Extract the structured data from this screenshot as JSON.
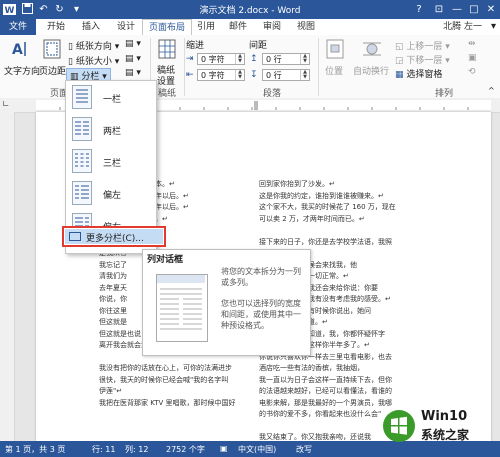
{
  "titlebar": {
    "title": "演示文档 2.docx - Word",
    "help": "?",
    "min": "—",
    "max": "□",
    "close": "✕"
  },
  "tabs": [
    "文件",
    "开始",
    "插入",
    "设计",
    "页面布局",
    "引用",
    "邮件",
    "审阅",
    "视图"
  ],
  "active_tab": "页面布局",
  "user": "北腾 左一",
  "ribbon": {
    "text_direction": "文字方向",
    "margins": "页边距",
    "orientation": "纸张方向",
    "size": "纸张大小",
    "columns": "分栏",
    "page_group_partial": "页面",
    "draft": "稿纸",
    "draft_settings_1": "稿纸",
    "draft_settings_2": "设置",
    "draft_group": "稿纸",
    "indent_label": "缩进",
    "spacing_label": "间距",
    "indent_left": "0 字符",
    "indent_right": "0 字符",
    "space_before": "0 行",
    "space_after": "0 行",
    "paragraph_group": "段落",
    "position": "位置",
    "wrap_text": "自动换行",
    "bring_forward": "上移一层",
    "send_backward": "下移一层",
    "selection_pane": "选择窗格",
    "arrange_group": "排列"
  },
  "menu": {
    "items": [
      "一栏",
      "两栏",
      "三栏",
      "偏左",
      "偏右"
    ],
    "more": "更多分栏(C)..."
  },
  "tooltip": {
    "title": "列对话框",
    "desc1": "将您的文本拆分为一列或多列。",
    "desc2": "您也可以选择列的宽度和间距，或使用其中一种预设格式。"
  },
  "doc": {
    "left_col": [
      "的子成了巴黎作业本。↵",
      "了，在我们结婚两年以后。↵",
      "了，在我们结婚两年以后。↵",
      "，我们都爱说出来。↵",
      "",
      "我缘在客厅",
      "是我从客",
      "我忘记了",
      "清我们为",
      "去年夏天",
      "你说，你",
      "你往这里",
      "但这就是",
      "但这就是也说，这都是经历比你不解么↵",
      "离开我会就会退不要与持那些事。↵",
      "",
      "我没有把你的话放在心上，可你的法满进步",
      "很快，我天的时候你已经会喊\"我的名字叫",
      "伊莲\"↵",
      "我把在医背那家 KTV 里唱歌，那时候中国好"
    ],
    "right_col": [
      "回到家你抬到了沙发。↵",
      "这是你我的约定，谁抬到谁谁被赚来。↵",
      "这个家不大，我买的时候花了 160 万，现在",
      "可以卖 2 万，才两年时间而已。↵",
      "",
      "接下来的日子，你还是去学校学法语，我照",
      "",
      "接下来，你有时候会来找我，他",
      "是你的，你变得一切正常。↵",
      "种，一切正常，我还会来给你说：你要",
      "分手的时候，你我有没有考虑我的感受。↵",
      "那样你结婚才会有时候你说出，她问",
      "了解你，我也知道。↵",
      "不对，说我也不知道，我，你都怀疑怀字",
      "了，你一样，我这样你半年多了。↵",
      "你说你只喜欢你一样去三里屯看电影，也去",
      "酒店吃一些有法的香槟，我抽烟，",
      "我一直以为日子会这样一直持续下去，但你",
      "的法语越来越好，已经可以看懂法，看谁的",
      "电影来解，那是我最好的一个男演员，我哪",
      "的书你的爱不多，你看起来也没什么会\"",
      "",
      "我又结束了。你又抱我亲吻，还说我",
      "以还给我，我真不错。↵"
    ]
  },
  "status": {
    "page": "第 1 页，共 3 页",
    "row": "行: 11",
    "col": "列: 12",
    "words": "2752 个字",
    "lang": "中文(中国)",
    "overtype": "改写"
  },
  "watermark": {
    "line1": "Win10",
    "line2": "系统之家"
  },
  "colors": {
    "accent": "#2b579a",
    "highlight": "#c5dcf5",
    "callout": "#e23b2e"
  }
}
